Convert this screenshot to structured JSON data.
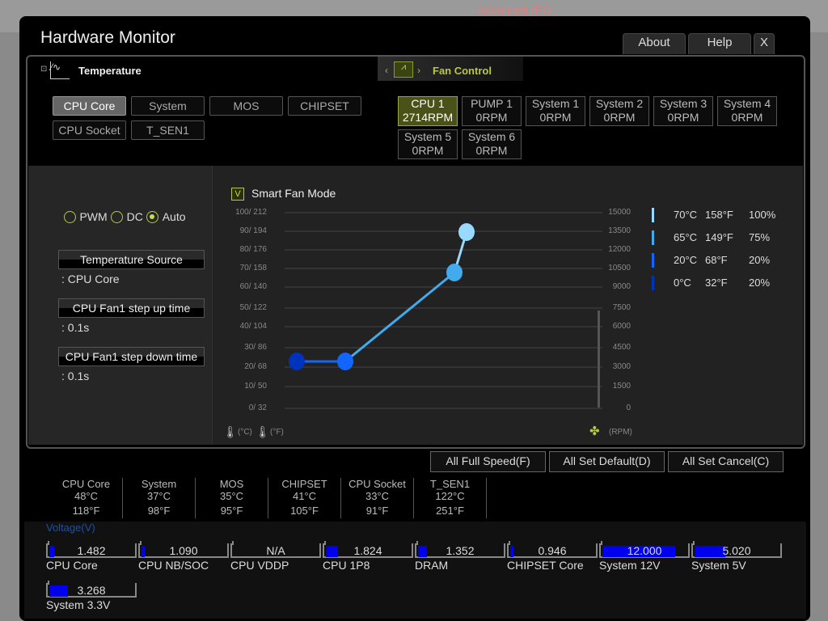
{
  "background": {
    "advanced_tab": "Advanced (F7)"
  },
  "window": {
    "title": "Hardware Monitor",
    "buttons": [
      "About",
      "Help",
      "X"
    ]
  },
  "temperature": {
    "header": "Temperature",
    "sources": [
      {
        "label": "CPU Core",
        "active": true
      },
      {
        "label": "System"
      },
      {
        "label": "MOS"
      },
      {
        "label": "CHIPSET"
      },
      {
        "label": "CPU Socket"
      },
      {
        "label": "T_SEN1"
      }
    ]
  },
  "fan_control": {
    "header": "Fan Control",
    "fans": [
      {
        "name": "CPU 1",
        "rpm": "2714RPM",
        "active": true
      },
      {
        "name": "PUMP 1",
        "rpm": "0RPM"
      },
      {
        "name": "System 1",
        "rpm": "0RPM"
      },
      {
        "name": "System 2",
        "rpm": "0RPM"
      },
      {
        "name": "System 3",
        "rpm": "0RPM"
      },
      {
        "name": "System 4",
        "rpm": "0RPM"
      },
      {
        "name": "System 5",
        "rpm": "0RPM"
      },
      {
        "name": "System 6",
        "rpm": "0RPM"
      }
    ]
  },
  "mode": {
    "options": [
      "PWM",
      "DC",
      "Auto"
    ],
    "selected": "Auto"
  },
  "settings": {
    "temp_source_label": "Temperature Source",
    "temp_source_value": ": CPU Core",
    "step_up_label": "CPU Fan1 step up time",
    "step_up_value": ": 0.1s",
    "step_down_label": "CPU Fan1 step down time",
    "step_down_value": ": 0.1s"
  },
  "smart_fan": {
    "label": "Smart Fan Mode",
    "checked": true,
    "check_glyph": "V"
  },
  "chart_data": {
    "type": "line",
    "left_ticks": [
      "100/ 212",
      "90/ 194",
      "80/ 176",
      "70/ 158",
      "60/ 140",
      "50/ 122",
      "40/ 104",
      "30/  86",
      "20/  68",
      "10/  50",
      "0/  32"
    ],
    "right_ticks": [
      "15000",
      "13500",
      "12000",
      "10500",
      "9000",
      "7500",
      "6000",
      "4500",
      "3000",
      "1500",
      "0"
    ],
    "left_unit_c": "(°C)",
    "left_unit_f": "(°F)",
    "right_unit": "(RPM)",
    "points": [
      {
        "temp_c": 0,
        "temp_f": 32,
        "percent": 20,
        "color": "#0033bb"
      },
      {
        "temp_c": 20,
        "temp_f": 68,
        "percent": 20,
        "color": "#1166ff"
      },
      {
        "temp_c": 65,
        "temp_f": 149,
        "percent": 75,
        "color": "#44aaee"
      },
      {
        "temp_c": 70,
        "temp_f": 158,
        "percent": 100,
        "color": "#99d8ff"
      }
    ],
    "legend": [
      {
        "c": "70°C",
        "f": "158°F",
        "p": "100%"
      },
      {
        "c": "65°C",
        "f": "149°F",
        "p": "75%"
      },
      {
        "c": "20°C",
        "f": "68°F",
        "p": "20%"
      },
      {
        "c": "0°C",
        "f": "32°F",
        "p": "20%"
      }
    ],
    "grid": true
  },
  "actions": [
    "All Full Speed(F)",
    "All Set Default(D)",
    "All Set Cancel(C)"
  ],
  "temps": [
    {
      "name": "CPU Core",
      "c": "48°C",
      "f": "118°F"
    },
    {
      "name": "System",
      "c": "37°C",
      "f": "98°F"
    },
    {
      "name": "MOS",
      "c": "35°C",
      "f": "95°F"
    },
    {
      "name": "CHIPSET",
      "c": "41°C",
      "f": "105°F"
    },
    {
      "name": "CPU Socket",
      "c": "33°C",
      "f": "91°F"
    },
    {
      "name": "T_SEN1",
      "c": "122°C",
      "f": "251°F"
    }
  ],
  "voltage": {
    "header": "Voltage(V)",
    "items": [
      {
        "name": "CPU Core",
        "value": "1.482",
        "level": 0.06
      },
      {
        "name": "CPU NB/SOC",
        "value": "1.090",
        "level": 0.04
      },
      {
        "name": "CPU VDDP",
        "value": "N/A",
        "level": 0
      },
      {
        "name": "CPU 1P8",
        "value": "1.824",
        "level": 0.14
      },
      {
        "name": "DRAM",
        "value": "1.352",
        "level": 0.1
      },
      {
        "name": "CHIPSET Core",
        "value": "0.946",
        "level": 0.04
      },
      {
        "name": "System 12V",
        "value": "12.000",
        "level": 0.85
      },
      {
        "name": "System 5V",
        "value": "5.020",
        "level": 0.36
      },
      {
        "name": "System 3.3V",
        "value": "3.268",
        "level": 0.22
      }
    ]
  }
}
